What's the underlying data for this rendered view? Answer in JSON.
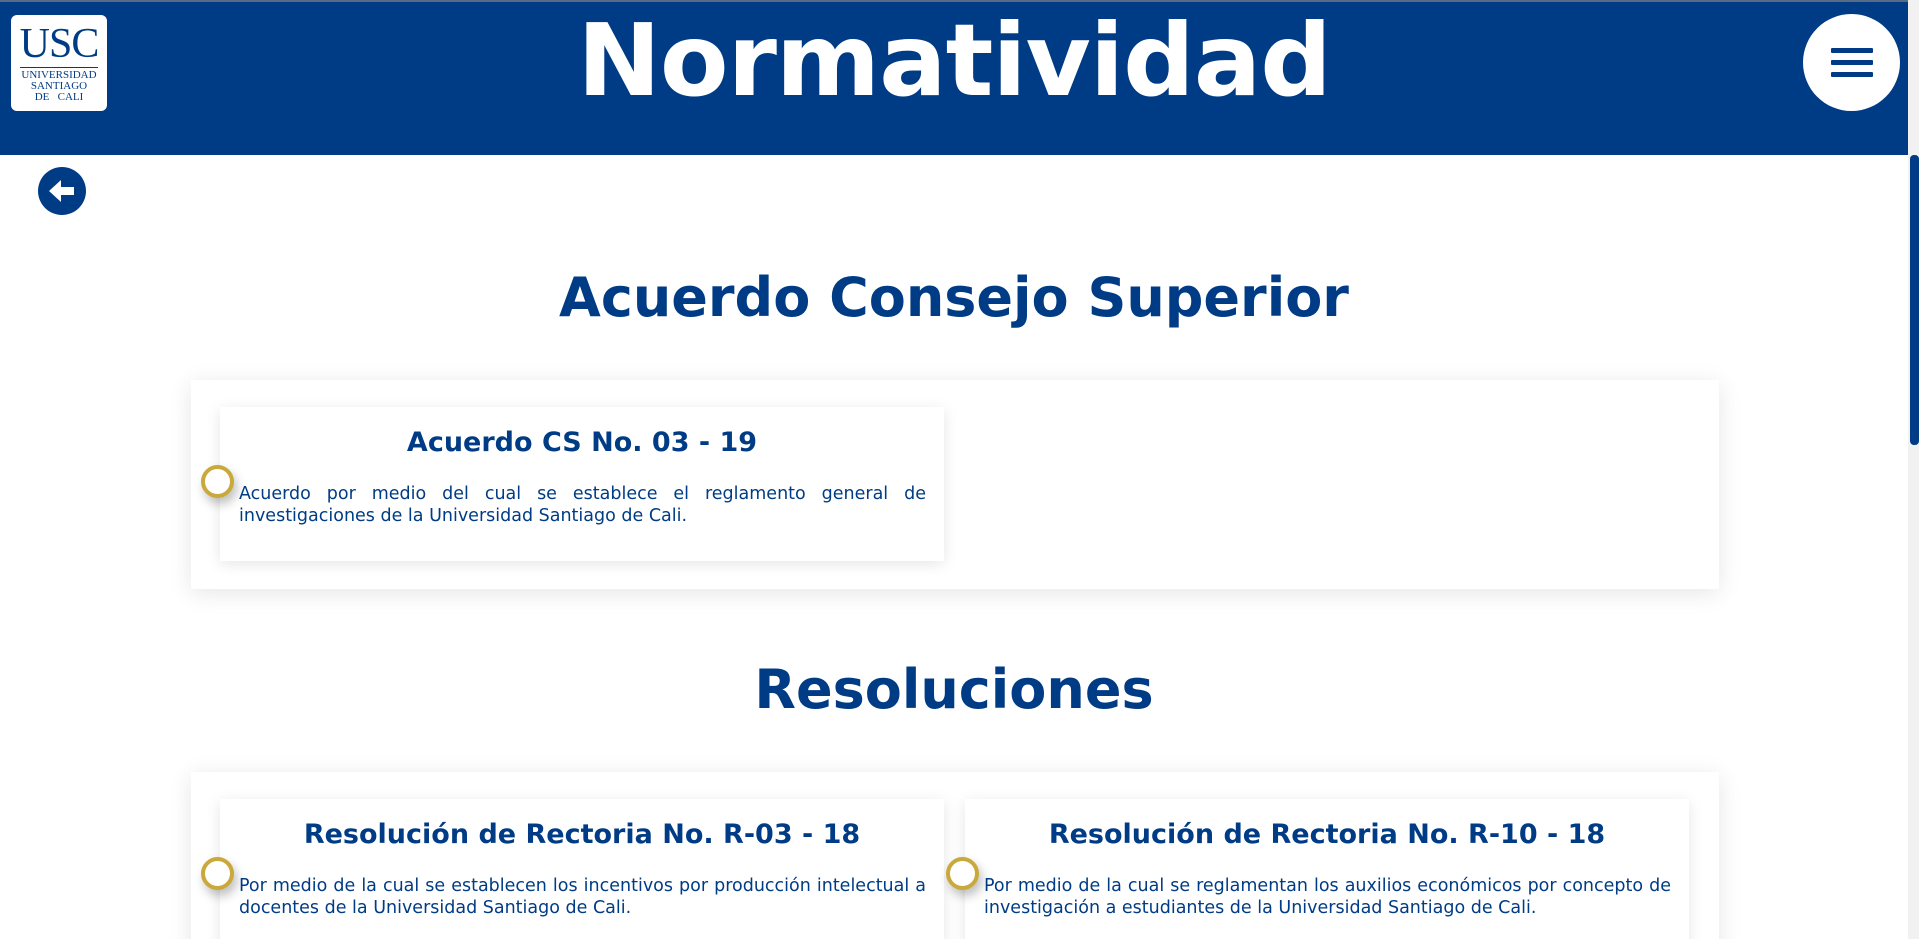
{
  "header": {
    "title": "Normatividad",
    "logo": {
      "mark": "USC",
      "line1": "UNIVERSIDAD",
      "line2": "SANTIAGO",
      "line3": "DE   CALI"
    },
    "menu_icon": "hamburger-menu-icon",
    "color": "#003c85"
  },
  "back_icon": "arrow-left-icon",
  "accent_color": "#c9a83c",
  "sections": [
    {
      "title": "Acuerdo Consejo Superior",
      "cards": [
        {
          "title": "Acuerdo CS No. 03 - 19",
          "description": "Acuerdo por medio del cual se establece el reglamento general de investigaciones de la Universidad Santiago de Cali."
        }
      ]
    },
    {
      "title": "Resoluciones",
      "cards": [
        {
          "title": "Resolución de Rectoria No. R-03 - 18",
          "description": "Por medio de la cual se establecen los incentivos por producción intelectual a docentes de la Universidad Santiago de Cali."
        },
        {
          "title": "Resolución de Rectoria No. R-10 - 18",
          "description": "Por medio de la cual se reglamentan los auxilios económicos por concepto de investigación a estudiantes de la Universidad Santiago de Cali."
        }
      ]
    }
  ]
}
